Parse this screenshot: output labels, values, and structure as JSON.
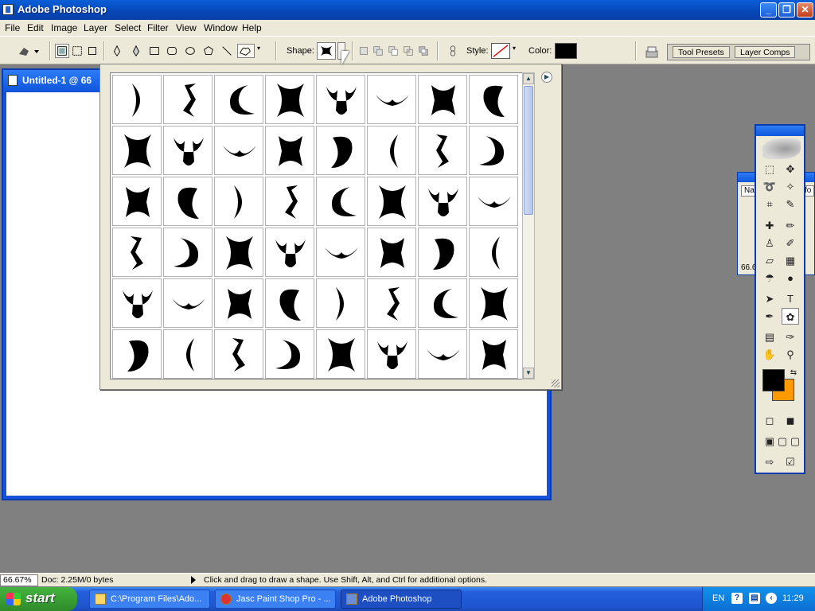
{
  "window": {
    "title": "Adobe Photoshop"
  },
  "menu": [
    "File",
    "Edit",
    "Image",
    "Layer",
    "Select",
    "Filter",
    "View",
    "Window",
    "Help"
  ],
  "options_bar": {
    "shape_label": "Shape:",
    "style_label": "Style:",
    "color_label": "Color:",
    "color_value": "#000000",
    "palette_well_tabs": [
      "Tool Presets",
      "Layer Comps"
    ]
  },
  "document": {
    "title": "Untitled-1 @ 66"
  },
  "side_panel": {
    "tab": "Na",
    "tab2": "fo",
    "zoom": "66.6"
  },
  "toolbox": {
    "foreground": "#000000",
    "background": "#ff9900"
  },
  "shape_picker": {
    "shapes": [
      "ornament-1",
      "ornament-2",
      "ornament-3",
      "ornament-4",
      "ornament-5",
      "ornament-6",
      "ornament-7",
      "ornament-8",
      "ornament-9",
      "ornament-10",
      "ornament-11",
      "ornament-12",
      "ornament-13",
      "ornament-14",
      "ornament-15",
      "ornament-16",
      "ornament-17",
      "ornament-18",
      "ornament-19",
      "ornament-20",
      "ornament-21",
      "ornament-22",
      "ornament-23",
      "ornament-24",
      "ornament-25",
      "ornament-26",
      "ornament-27",
      "ornament-28",
      "ornament-29",
      "ornament-30",
      "ornament-31",
      "ornament-32",
      "ornament-33",
      "ornament-34",
      "ornament-35",
      "ornament-36",
      "ornament-37",
      "ornament-38",
      "ornament-39",
      "ornament-40",
      "ornament-41",
      "ornament-42",
      "ornament-43",
      "ornament-44",
      "ornament-45",
      "ornament-46",
      "ornament-47",
      "ornament-48"
    ]
  },
  "statusbar": {
    "zoom": "66.67%",
    "doc": "Doc: 2.25M/0 bytes",
    "hint": "Click and drag to draw a shape. Use Shift, Alt, and Ctrl for additional options."
  },
  "taskbar": {
    "start": "start",
    "tasks": [
      {
        "label": "C:\\Program Files\\Ado..."
      },
      {
        "label": "Jasc Paint Shop Pro - ..."
      },
      {
        "label": "Adobe Photoshop"
      }
    ],
    "lang": "EN",
    "clock": "11:29"
  }
}
